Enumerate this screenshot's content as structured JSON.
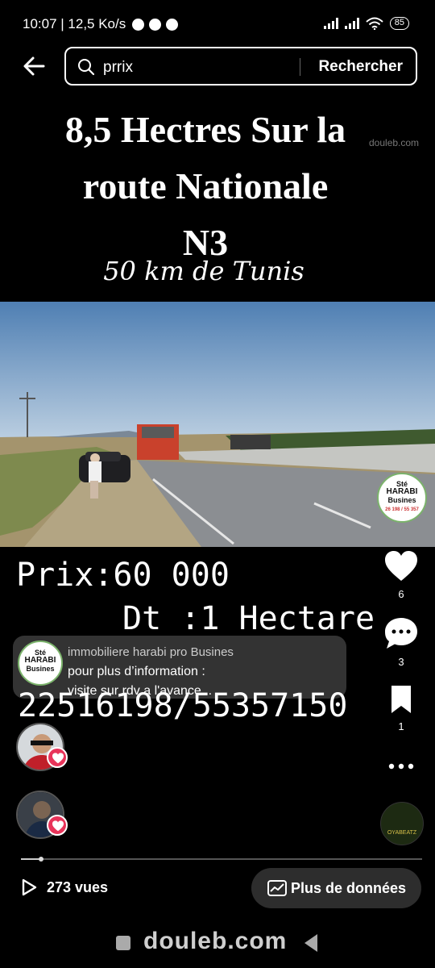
{
  "status_bar": {
    "time_speed": "10:07 | 12,5 Ko/s",
    "battery": "85",
    "icons": [
      "alarm-icon",
      "messenger-icon",
      "facebook-icon",
      "signal-icon",
      "signal-icon",
      "wifi-icon",
      "battery-icon"
    ]
  },
  "search": {
    "query": "prrix",
    "submit_label": "Rechercher"
  },
  "post": {
    "headline_line1": "8,5 Hectres Sur la",
    "headline_line2": "route Nationale",
    "headline_line3": "N3",
    "subline": "50 km de Tunis",
    "watermark_top": "douleb.com",
    "logo": {
      "line1": "Sté",
      "line2": "HARABI",
      "line3": "Busines",
      "line4": "26 198 / 55 357"
    },
    "price_line1": "Prix:60 000",
    "price_line2": "Dt :1 Hectare",
    "phone": "22516198/55357150"
  },
  "rail": {
    "likes": "6",
    "comments": "3",
    "saves": "1"
  },
  "comment": {
    "author": "immobiliere harabi pro Busines",
    "line1": "pour plus d’information :",
    "line2": "visite sur rdv a l'avance..."
  },
  "audio_badge": "OYABEATZ",
  "player": {
    "progress": 0.05,
    "views": "273 vues",
    "more_data_label": "Plus de données"
  },
  "nav": {
    "brand": "douleb.com"
  },
  "colors": {
    "background": "#000000",
    "heart_badge": "#e8345a",
    "pill": "#2d2d2d"
  }
}
